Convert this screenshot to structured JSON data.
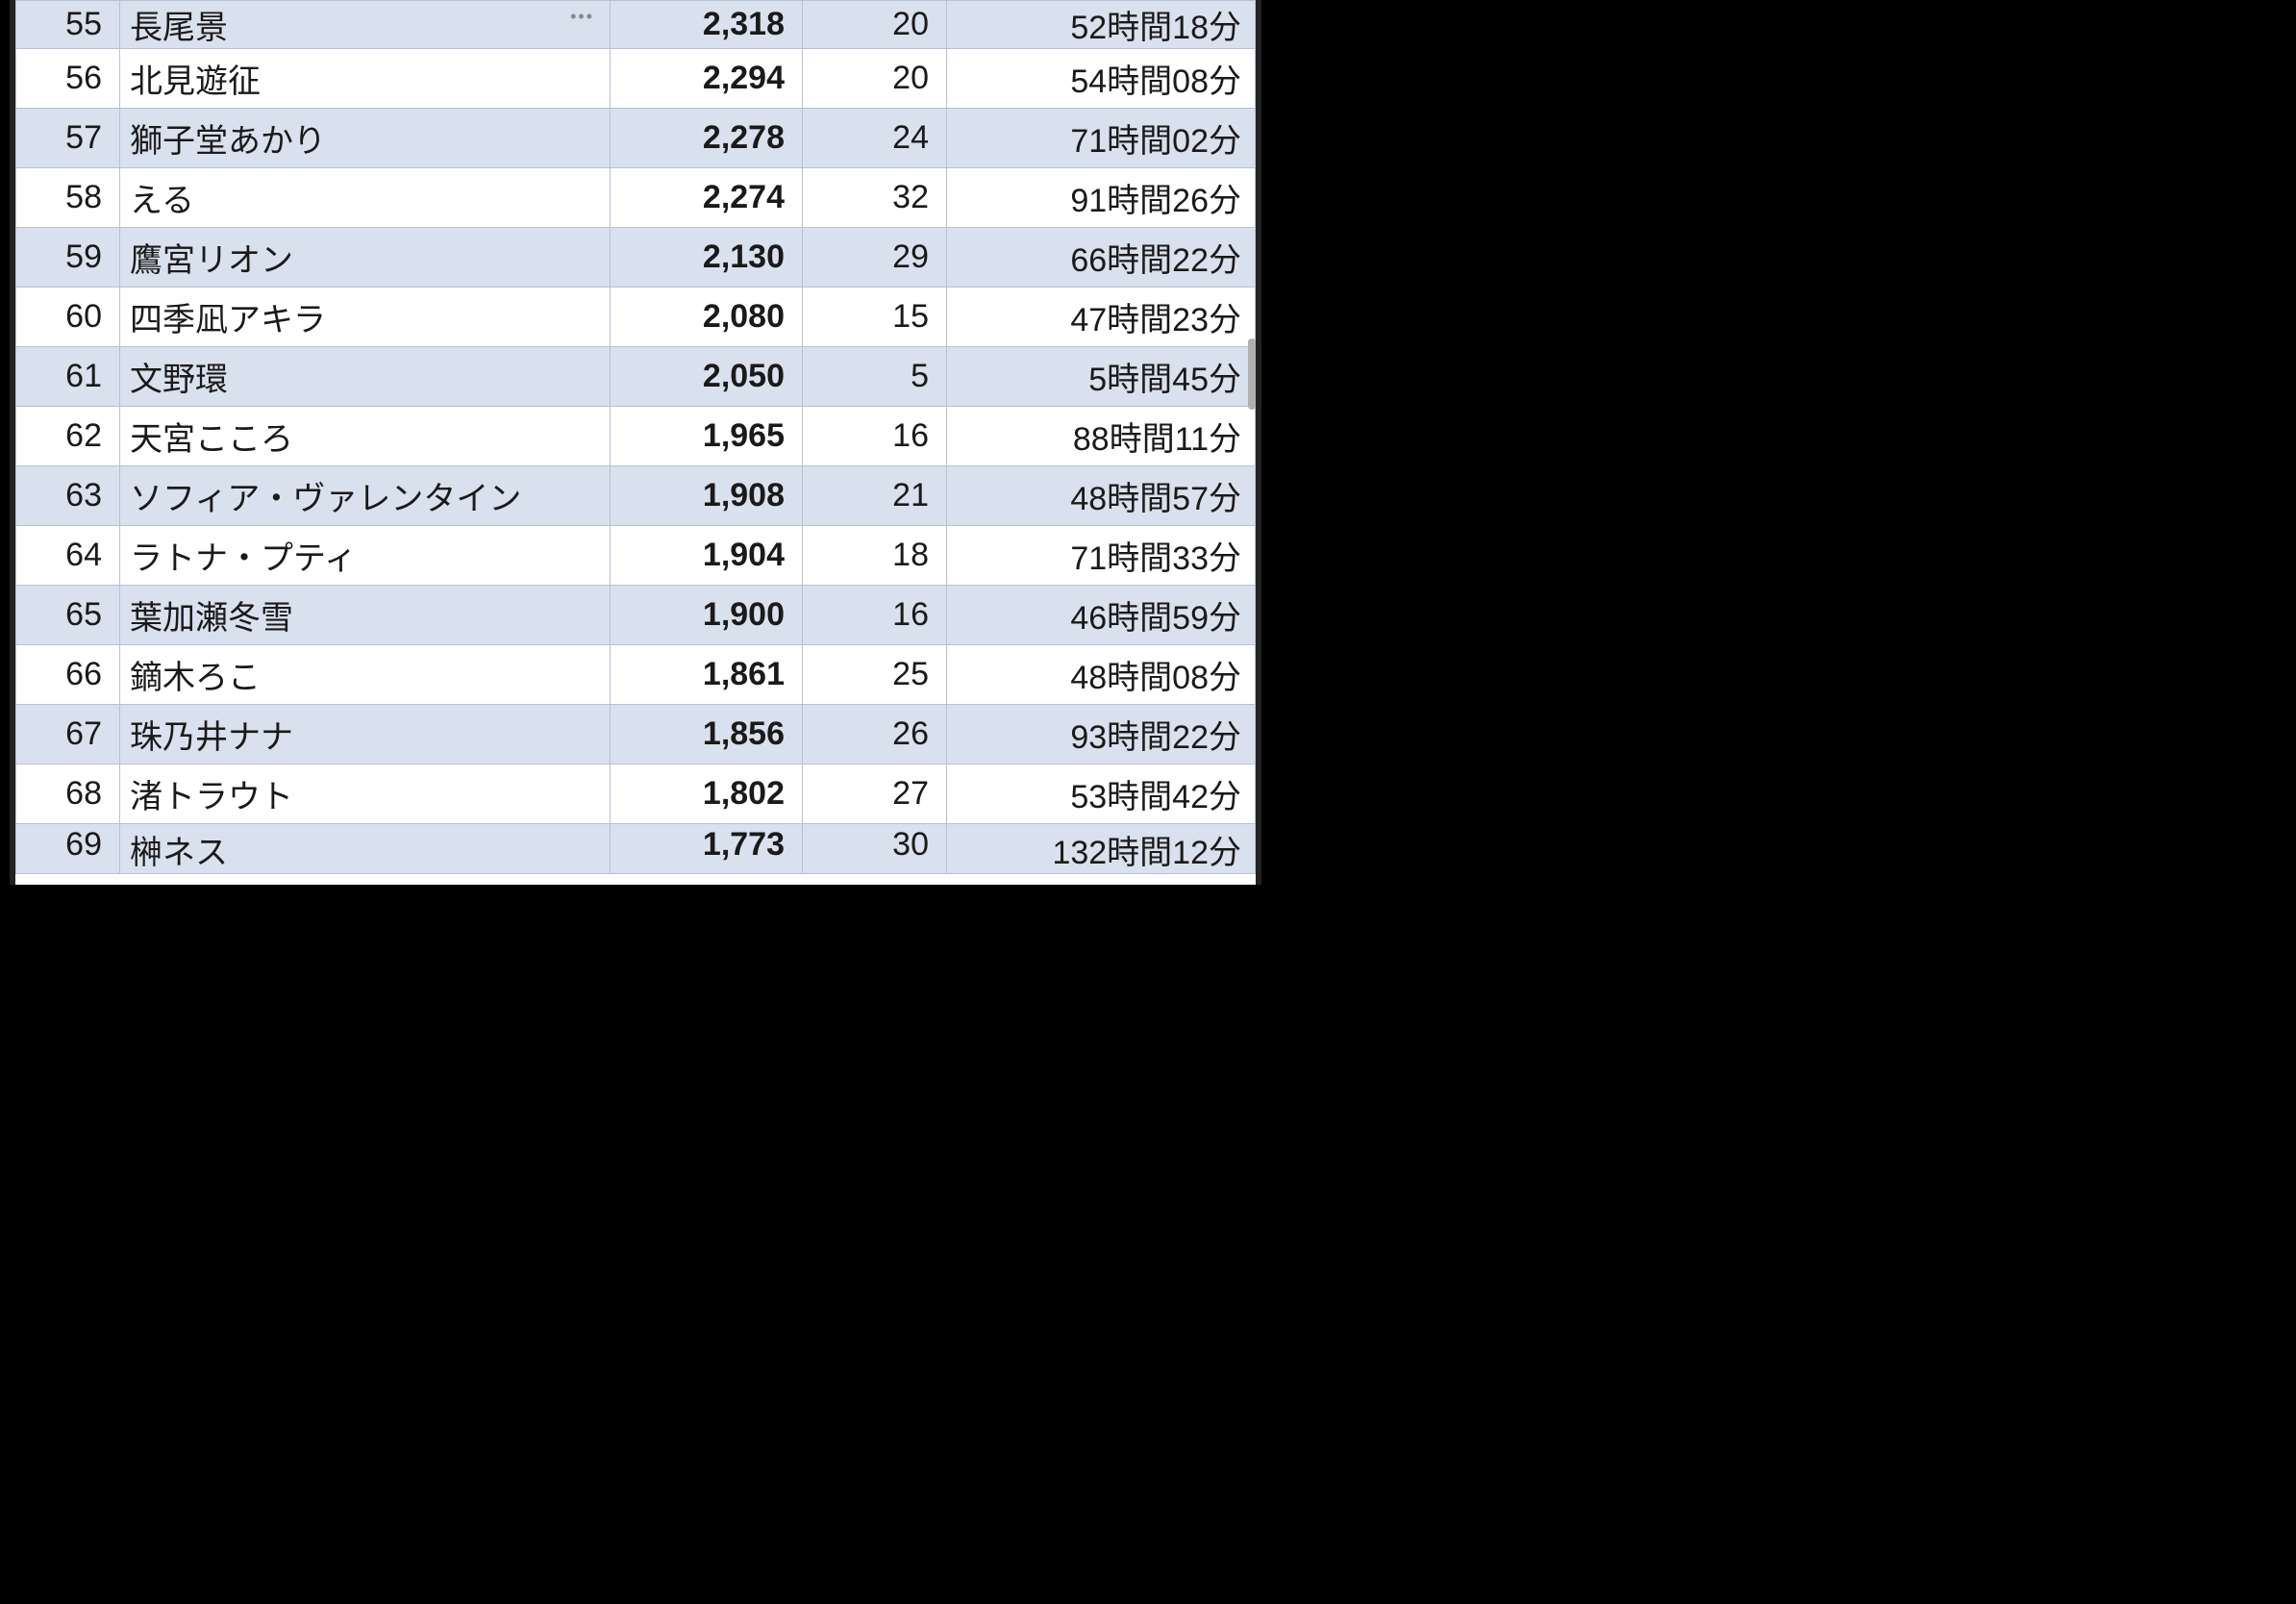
{
  "rows": [
    {
      "rank": "55",
      "name": "長尾景",
      "value": "2,318",
      "count": "20",
      "duration": "52時間18分",
      "ellipsis": true
    },
    {
      "rank": "56",
      "name": "北見遊征",
      "value": "2,294",
      "count": "20",
      "duration": "54時間08分"
    },
    {
      "rank": "57",
      "name": "獅子堂あかり",
      "value": "2,278",
      "count": "24",
      "duration": "71時間02分"
    },
    {
      "rank": "58",
      "name": "える",
      "value": "2,274",
      "count": "32",
      "duration": "91時間26分"
    },
    {
      "rank": "59",
      "name": "鷹宮リオン",
      "value": "2,130",
      "count": "29",
      "duration": "66時間22分"
    },
    {
      "rank": "60",
      "name": "四季凪アキラ",
      "value": "2,080",
      "count": "15",
      "duration": "47時間23分"
    },
    {
      "rank": "61",
      "name": "文野環",
      "value": "2,050",
      "count": "5",
      "duration": "5時間45分"
    },
    {
      "rank": "62",
      "name": "天宮こころ",
      "value": "1,965",
      "count": "16",
      "duration": "88時間11分"
    },
    {
      "rank": "63",
      "name": "ソフィア・ヴァレンタイン",
      "value": "1,908",
      "count": "21",
      "duration": "48時間57分"
    },
    {
      "rank": "64",
      "name": "ラトナ・プティ",
      "value": "1,904",
      "count": "18",
      "duration": "71時間33分"
    },
    {
      "rank": "65",
      "name": "葉加瀬冬雪",
      "value": "1,900",
      "count": "16",
      "duration": "46時間59分"
    },
    {
      "rank": "66",
      "name": "鏑木ろこ",
      "value": "1,861",
      "count": "25",
      "duration": "48時間08分"
    },
    {
      "rank": "67",
      "name": "珠乃井ナナ",
      "value": "1,856",
      "count": "26",
      "duration": "93時間22分"
    },
    {
      "rank": "68",
      "name": "渚トラウト",
      "value": "1,802",
      "count": "27",
      "duration": "53時間42分"
    },
    {
      "rank": "69",
      "name": "榊ネス",
      "value": "1,773",
      "count": "30",
      "duration": "132時間12分"
    }
  ]
}
